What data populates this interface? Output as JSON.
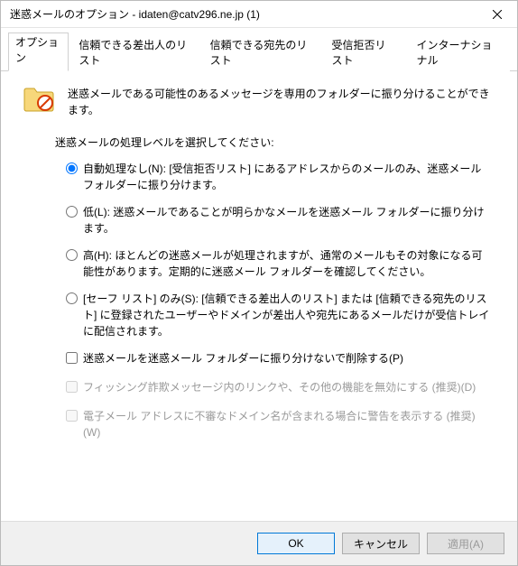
{
  "titlebar": {
    "title": "迷惑メールのオプション - idaten@catv296.ne.jp (1)"
  },
  "tabs": {
    "items": [
      {
        "label": "オプション"
      },
      {
        "label": "信頼できる差出人のリスト"
      },
      {
        "label": "信頼できる宛先のリスト"
      },
      {
        "label": "受信拒否リスト"
      },
      {
        "label": "インターナショナル"
      }
    ]
  },
  "content": {
    "intro": "迷惑メールである可能性のあるメッセージを専用のフォルダーに振り分けることができます。",
    "radio_prompt": "迷惑メールの処理レベルを選択してください:",
    "radios": [
      {
        "label": "自動処理なし(N): [受信拒否リスト] にあるアドレスからのメールのみ、迷惑メール フォルダーに振り分けます。"
      },
      {
        "label": "低(L): 迷惑メールであることが明らかなメールを迷惑メール フォルダーに振り分けます。"
      },
      {
        "label": "高(H): ほとんどの迷惑メールが処理されますが、通常のメールもその対象になる可能性があります。定期的に迷惑メール フォルダーを確認してください。"
      },
      {
        "label": "[セーフ リスト] のみ(S): [信頼できる差出人のリスト] または [信頼できる宛先のリスト] に登録されたユーザーやドメインが差出人や宛先にあるメールだけが受信トレイに配信されます。"
      }
    ],
    "checks": [
      {
        "label": "迷惑メールを迷惑メール フォルダーに振り分けないで削除する(P)"
      },
      {
        "label": "フィッシング詐欺メッセージ内のリンクや、その他の機能を無効にする (推奨)(D)"
      },
      {
        "label": "電子メール アドレスに不審なドメイン名が含まれる場合に警告を表示する (推奨)(W)"
      }
    ]
  },
  "buttons": {
    "ok": "OK",
    "cancel": "キャンセル",
    "apply": "適用(A)"
  }
}
